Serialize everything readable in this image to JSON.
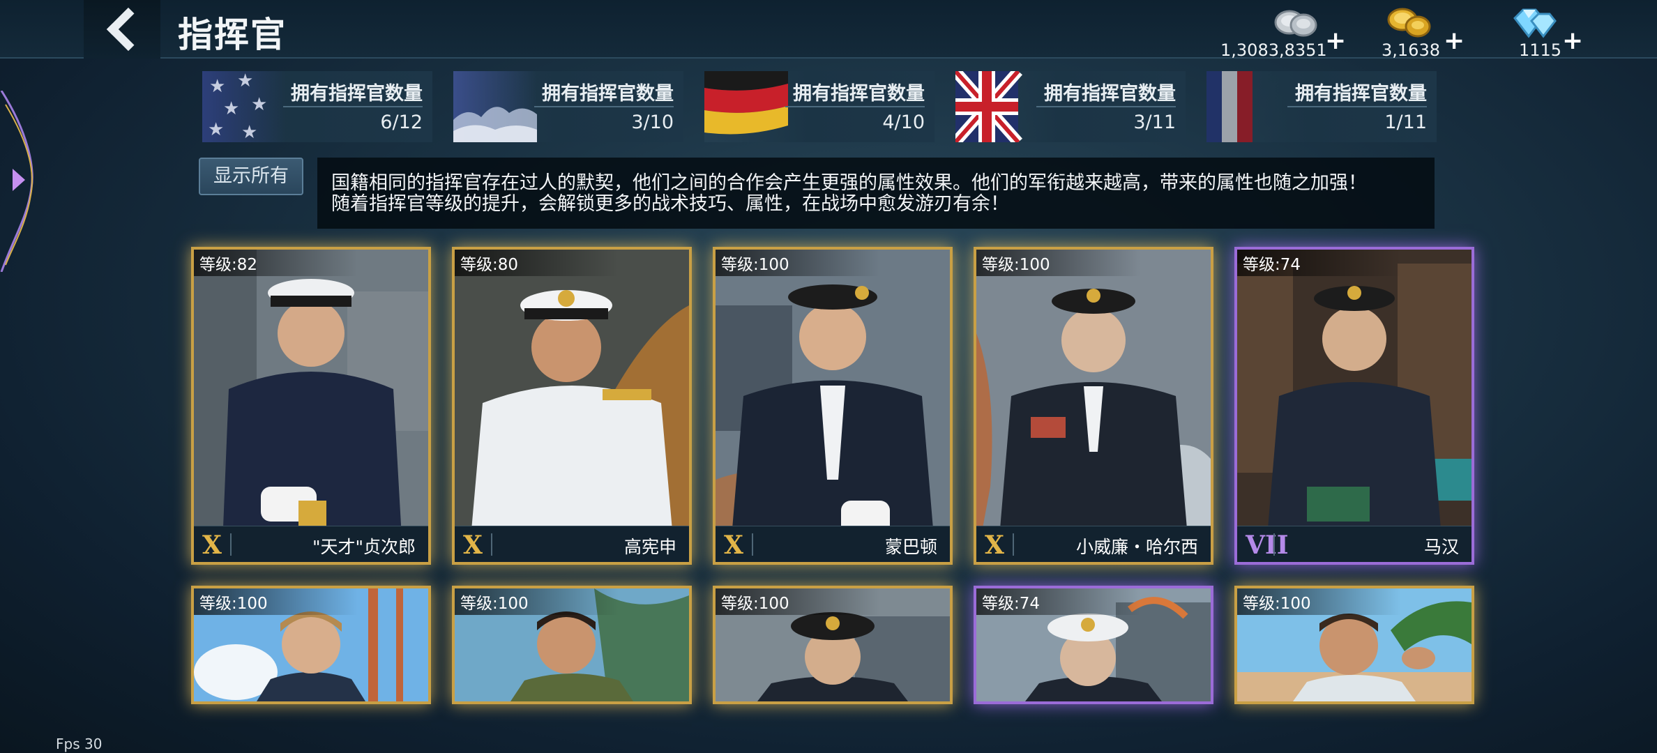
{
  "header": {
    "title": "指挥官",
    "currencies": [
      {
        "name": "silver",
        "amount": "1,3083,8351",
        "icon": "silver-coins-icon"
      },
      {
        "name": "gold",
        "amount": "3,1638",
        "icon": "gold-coins-icon"
      },
      {
        "name": "diamond",
        "amount": "1115",
        "icon": "diamond-icon"
      }
    ],
    "plus": "+"
  },
  "nations": [
    {
      "flag": "usa-flag",
      "label": "拥有指挥官数量",
      "count": "6/12"
    },
    {
      "flag": "japan-flag",
      "label": "拥有指挥官数量",
      "count": "3/10"
    },
    {
      "flag": "germany-flag",
      "label": "拥有指挥官数量",
      "count": "4/10"
    },
    {
      "flag": "uk-flag",
      "label": "拥有指挥官数量",
      "count": "3/11"
    },
    {
      "flag": "france-flag",
      "label": "拥有指挥官数量",
      "count": "1/11"
    }
  ],
  "show_all_label": "显示所有",
  "description": {
    "line1": "国籍相同的指挥官存在过人的默契，他们之间的合作会产生更强的属性效果。他们的军衔越来越高，带来的属性也随之加强！",
    "line2": "随着指挥官等级的提升，会解锁更多的战术技巧、属性，在战场中愈发游刃有余！"
  },
  "commanders": [
    {
      "level": "等级:82",
      "rank": "X",
      "name": "\"天才\"贞次郎",
      "frame": "gold"
    },
    {
      "level": "等级:80",
      "rank": "X",
      "name": "高宪申",
      "frame": "gold"
    },
    {
      "level": "等级:100",
      "rank": "X",
      "name": "蒙巴顿",
      "frame": "gold"
    },
    {
      "level": "等级:100",
      "rank": "X",
      "name": "小威廉・哈尔西",
      "frame": "gold"
    },
    {
      "level": "等级:74",
      "rank": "VII",
      "name": "马汉",
      "frame": "purple"
    },
    {
      "level": "等级:100",
      "frame": "gold"
    },
    {
      "level": "等级:100",
      "frame": "gold"
    },
    {
      "level": "等级:100",
      "frame": "gold"
    },
    {
      "level": "等级:74",
      "frame": "purple"
    },
    {
      "level": "等级:100",
      "frame": "gold"
    }
  ],
  "fps": "Fps 30",
  "colors": {
    "gold_frame": "#c9a045",
    "purple_frame": "#9b6cd8",
    "background": "#1a3243"
  }
}
